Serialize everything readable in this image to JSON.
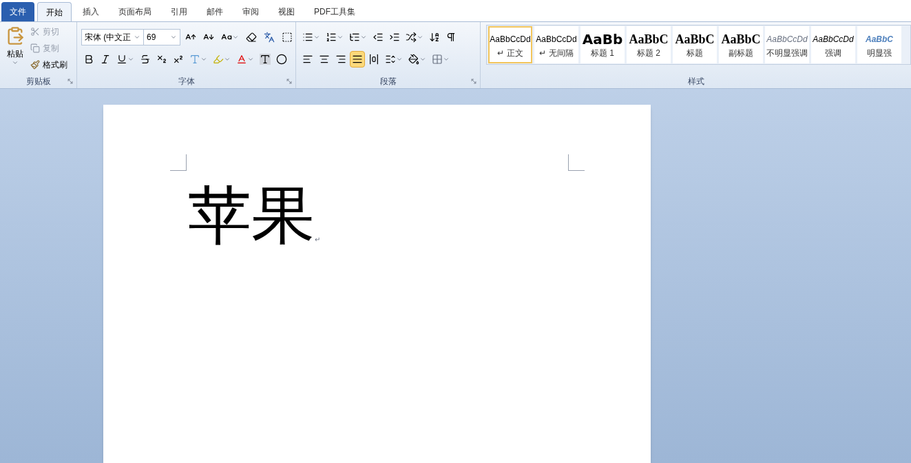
{
  "tabs": [
    {
      "label": "文件",
      "kind": "file",
      "selected": false
    },
    {
      "label": "开始",
      "kind": "normal",
      "selected": true
    },
    {
      "label": "插入",
      "kind": "normal",
      "selected": false
    },
    {
      "label": "页面布局",
      "kind": "normal",
      "selected": false
    },
    {
      "label": "引用",
      "kind": "normal",
      "selected": false
    },
    {
      "label": "邮件",
      "kind": "normal",
      "selected": false
    },
    {
      "label": "审阅",
      "kind": "normal",
      "selected": false
    },
    {
      "label": "视图",
      "kind": "normal",
      "selected": false
    },
    {
      "label": "PDF工具集",
      "kind": "normal",
      "selected": false
    }
  ],
  "clipboard": {
    "paste": "粘贴",
    "items": [
      {
        "kind": "cut",
        "label": "剪切",
        "disabled": true
      },
      {
        "kind": "copy",
        "label": "复制",
        "disabled": true
      },
      {
        "kind": "painter",
        "label": "格式刷",
        "disabled": false
      }
    ],
    "group_label": "剪贴板"
  },
  "font": {
    "font_name": "宋体 (中文正",
    "font_size": "69",
    "group_label": "字体"
  },
  "paragraph": {
    "alignments": [
      {
        "kind": "left",
        "selected": false
      },
      {
        "kind": "center",
        "selected": false
      },
      {
        "kind": "right",
        "selected": false
      },
      {
        "kind": "justify",
        "selected": true
      },
      {
        "kind": "distributed",
        "selected": false
      }
    ],
    "group_label": "段落"
  },
  "styles": {
    "group_label": "样式",
    "items": [
      {
        "sample": "AaBbCcDd",
        "label": "↵ 正文",
        "kind": "normal",
        "selected": true
      },
      {
        "sample": "AaBbCcDd",
        "label": "↵ 无间隔",
        "kind": "normal",
        "selected": false
      },
      {
        "sample": "AaBb",
        "label": "标题 1",
        "kind": "heading1",
        "selected": false
      },
      {
        "sample": "AaBbC",
        "label": "标题 2",
        "kind": "heading2",
        "selected": false
      },
      {
        "sample": "AaBbC",
        "label": "标题",
        "kind": "heading2",
        "selected": false
      },
      {
        "sample": "AaBbC",
        "label": "副标题",
        "kind": "heading2",
        "selected": false
      },
      {
        "sample": "AaBbCcDd",
        "label": "不明显强调",
        "kind": "subtle",
        "selected": false
      },
      {
        "sample": "AaBbCcDd",
        "label": "强调",
        "kind": "emphasis",
        "selected": false
      },
      {
        "sample": "AaBbC",
        "label": "明显强",
        "kind": "intense",
        "selected": false
      }
    ]
  },
  "document": {
    "text": "苹果",
    "paragraph_mark": "↵"
  }
}
